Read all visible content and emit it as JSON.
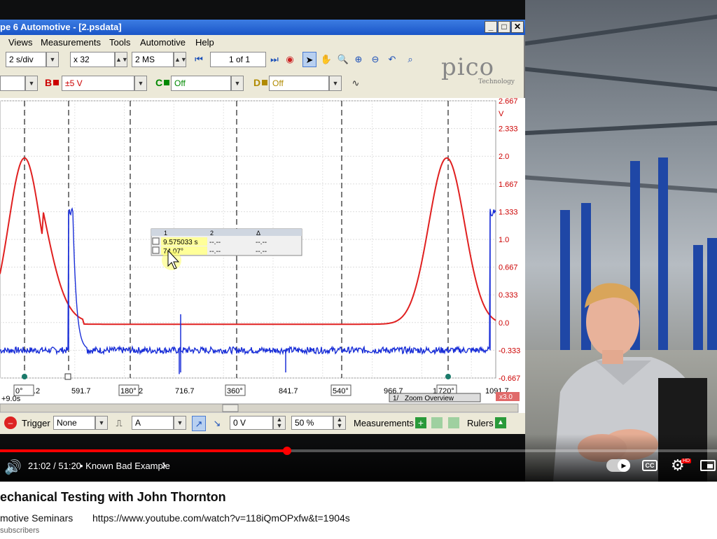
{
  "window": {
    "title": "pe 6 Automotive - [2.psdata]",
    "min_label": "_",
    "max_label": "□",
    "close_label": "✕"
  },
  "menu": [
    "Views",
    "Measurements",
    "Tools",
    "Automotive",
    "Help"
  ],
  "toolbar": {
    "timebase": "2 s/div",
    "zoom": "x 32",
    "samples": "2 MS",
    "page": "1 of 1"
  },
  "channels": {
    "b_label": "B",
    "b_range": "±5 V",
    "c_label": "C",
    "c_value": "Off",
    "d_label": "D",
    "d_value": "Off"
  },
  "logo": {
    "brand": "pico",
    "sub": "Technology"
  },
  "chart_data": {
    "type": "line",
    "y_ticks": [
      "2.667",
      "2.333",
      "2.0",
      "1.667",
      "1.333",
      "1.0",
      "0.667",
      "0.333",
      "0.0",
      "-0.333",
      "-0.667"
    ],
    "y_unit": "V",
    "x_tick_labels": [
      "0°",
      ".2",
      "591.7",
      "180°",
      "2",
      "716.7",
      "360°",
      "841.7",
      "540°",
      "966.7",
      "1",
      "720°",
      "1091.7"
    ],
    "x_offset_label": "+9.0s",
    "series": [
      {
        "color": "#e02020",
        "values_desc": "peaks"
      },
      {
        "color": "#1a2fd8",
        "values_desc": "pulses"
      }
    ],
    "red_peaks_y": 2.0,
    "blue_baseline_y": -0.333,
    "blue_pulse_y": 1.333,
    "zoom_badge": "x3.0",
    "zoom_overview": "Zoom Overview",
    "zoom_overview_num": "1/"
  },
  "measure_table": {
    "headers": [
      "1",
      "2",
      "Δ"
    ],
    "row1": [
      "9.575033 s",
      "--.--",
      "--.--"
    ],
    "row2": [
      "74.07°",
      "--.--",
      "--.--"
    ]
  },
  "bottom": {
    "trigger_label": "Trigger",
    "trigger_mode": "None",
    "trigger_channel": "A",
    "threshold": "0 V",
    "pre_trigger": "50 %",
    "measurements_label": "Measurements",
    "rulers_label": "Rulers"
  },
  "player": {
    "time": "21:02 / 51:20",
    "chapter": "• Known Bad Example",
    "chapter_arrow": "›",
    "cc_label": "CC",
    "hd_badge": "HD"
  },
  "video": {
    "title": "echanical Testing with John Thornton",
    "channel": "motive Seminars",
    "url": "https://www.youtube.com/watch?v=118iQmOPxfw&t=1904s",
    "subscribers": "subscribers"
  }
}
